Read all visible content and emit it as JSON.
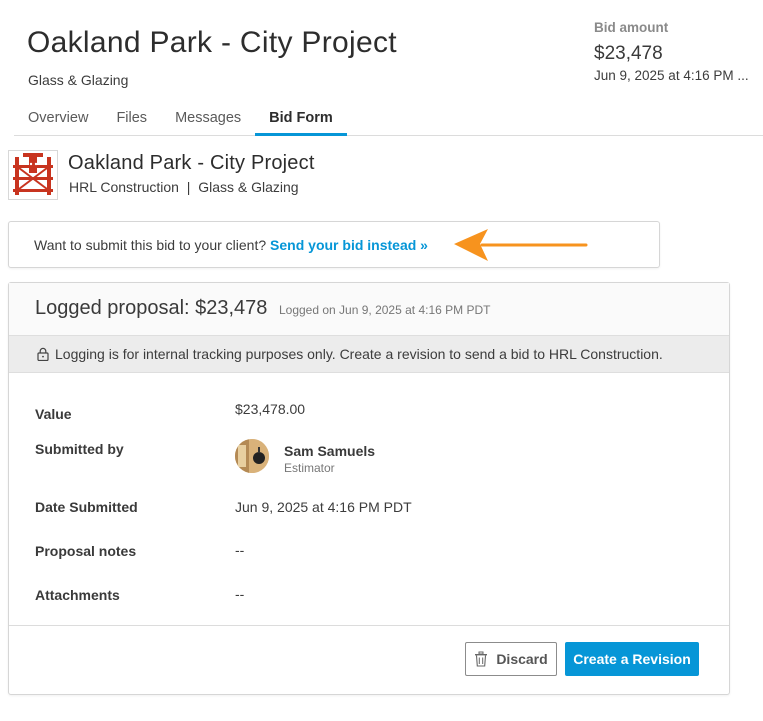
{
  "header": {
    "title": "Oakland Park - City Project",
    "subtitle": "Glass & Glazing",
    "bid_label": "Bid amount",
    "bid_value": "$23,478",
    "bid_date": "Jun 9, 2025 at 4:16 PM ..."
  },
  "tabs": [
    {
      "label": "Overview",
      "active": false
    },
    {
      "label": "Files",
      "active": false
    },
    {
      "label": "Messages",
      "active": false
    },
    {
      "label": "Bid Form",
      "active": true
    }
  ],
  "company": {
    "project_name": "Oakland Park - City Project",
    "client": "HRL Construction",
    "separator": "|",
    "trade": "Glass & Glazing"
  },
  "notice": {
    "text": "Want to submit this bid to your client?",
    "link": "Send your bid instead »"
  },
  "proposal": {
    "title": "Logged proposal: $23,478",
    "logged_on": "Logged on Jun 9, 2025 at 4:16 PM PDT",
    "info": "Logging is for internal tracking purposes only. Create a revision to send a bid to HRL Construction.",
    "fields": {
      "value_label": "Value",
      "value": "$23,478.00",
      "submitted_by_label": "Submitted by",
      "submitter_name": "Sam Samuels",
      "submitter_role": "Estimator",
      "date_label": "Date Submitted",
      "date": "Jun 9, 2025 at 4:16 PM PDT",
      "notes_label": "Proposal notes",
      "notes": "--",
      "attachments_label": "Attachments",
      "attachments": "--"
    },
    "buttons": {
      "discard": "Discard",
      "create_revision": "Create a Revision"
    }
  },
  "colors": {
    "accent": "#0696d7",
    "arrow": "#f7931e",
    "logo_red": "#c8341f"
  },
  "icons": [
    "company-logo",
    "lock-icon",
    "trash-icon",
    "arrow-annotation",
    "avatar"
  ]
}
